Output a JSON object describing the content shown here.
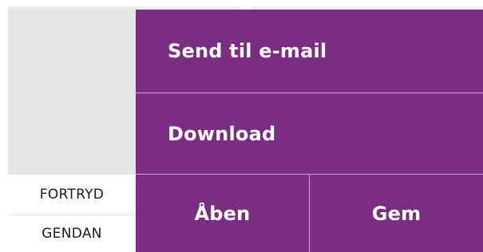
{
  "menu": {
    "send_email_label": "Send til e-mail",
    "download_label": "Download"
  },
  "actions": {
    "open_label": "Åben",
    "save_label": "Gem"
  },
  "history": {
    "undo_label": "FORTRYD",
    "redo_label": "GENDAN"
  },
  "colors": {
    "accent": "#7a2e83",
    "panel_gray": "#e5e5e5"
  }
}
